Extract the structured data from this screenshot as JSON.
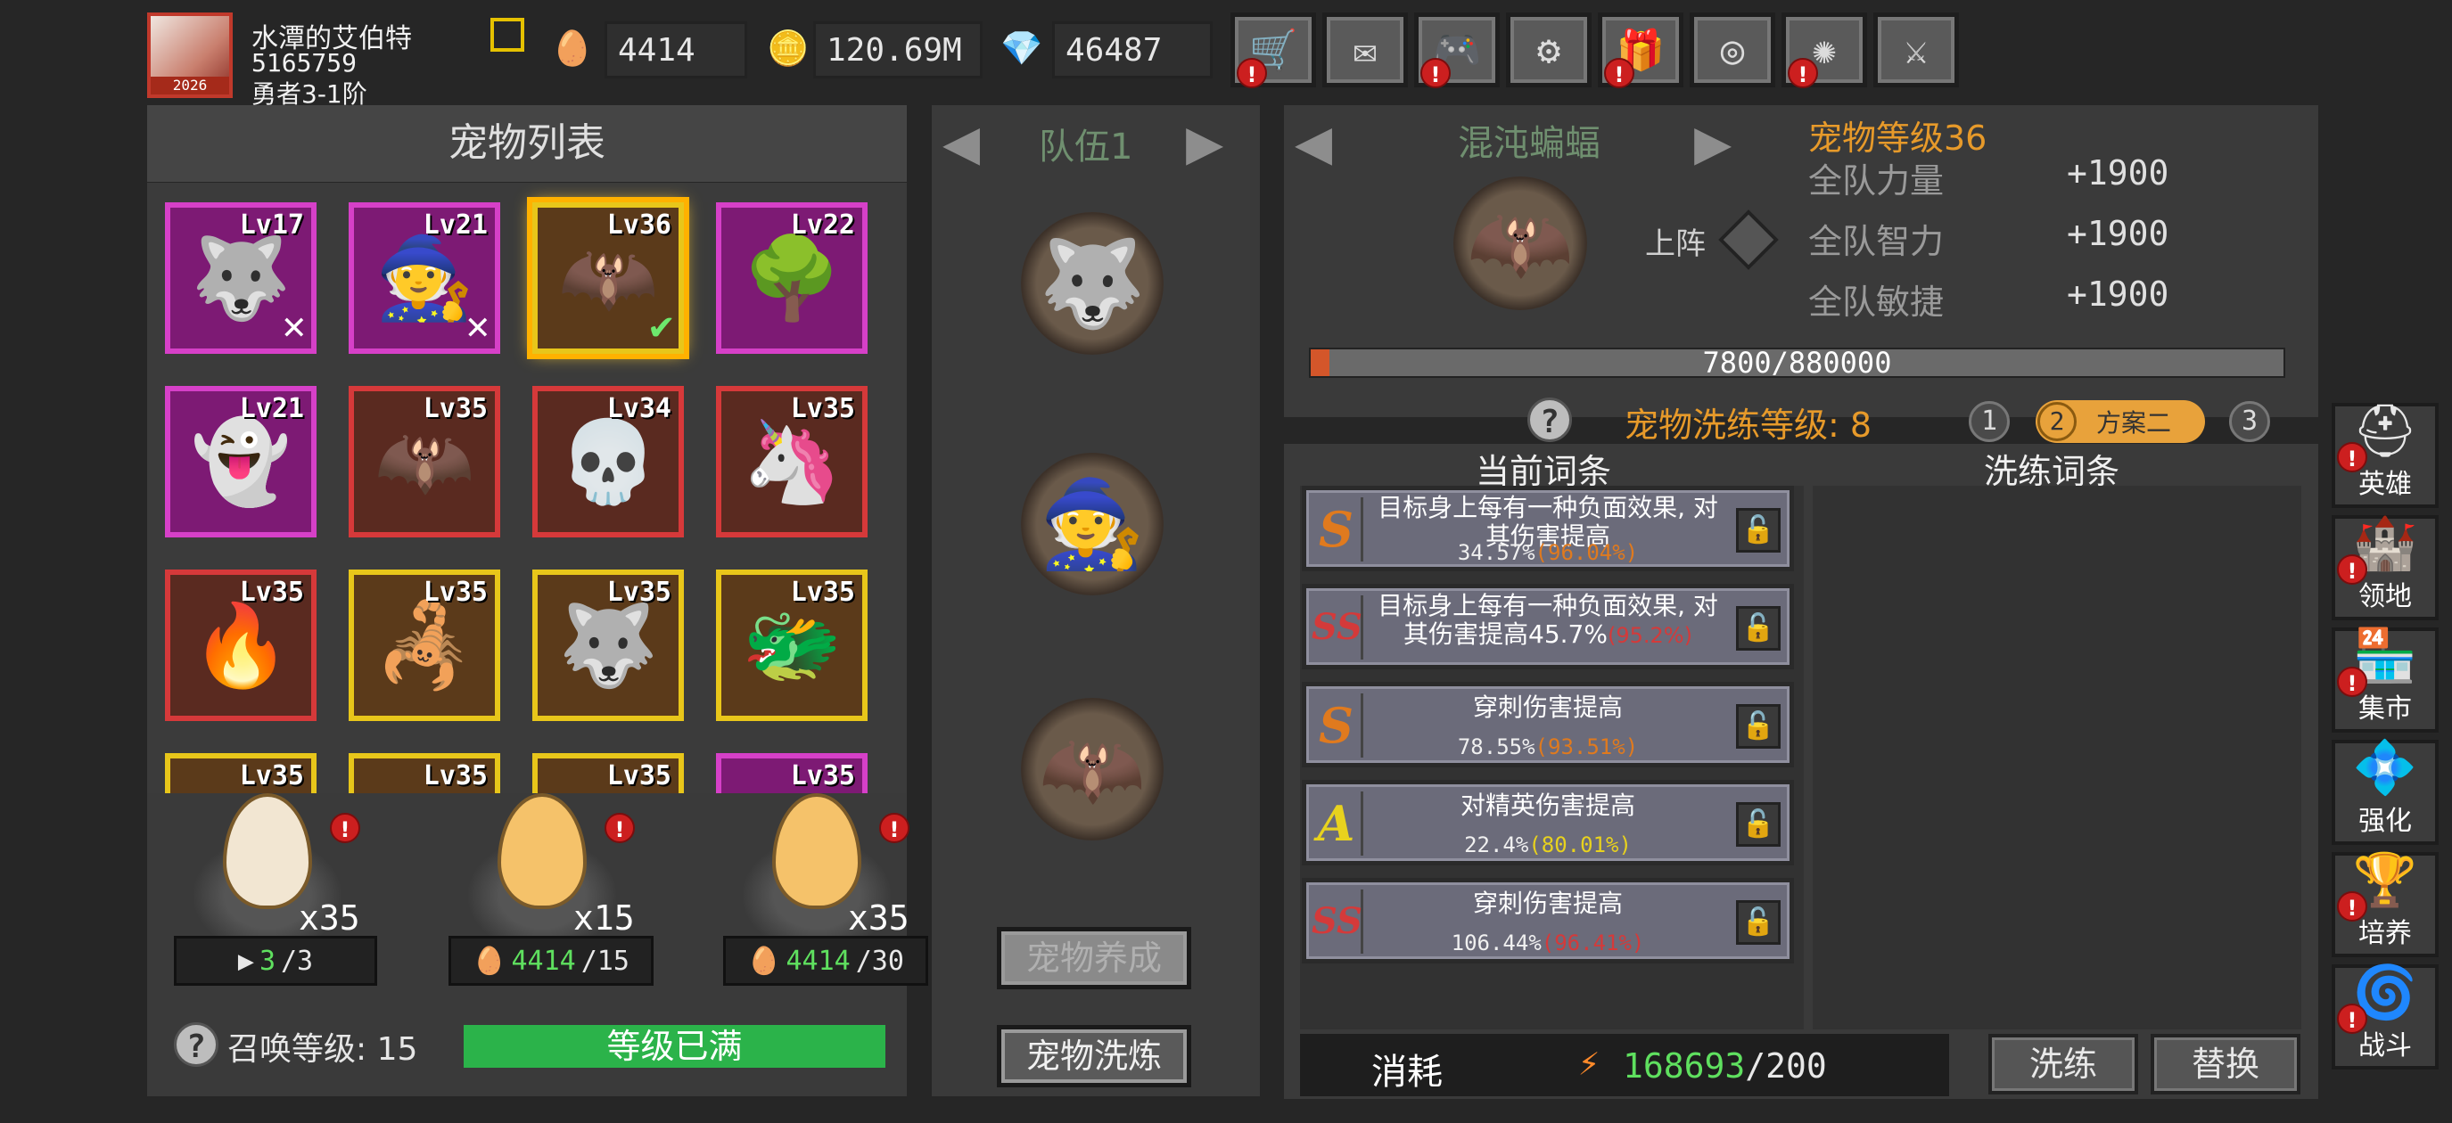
{
  "player": {
    "name": "水潭的艾伯特",
    "id": "5165759",
    "rank": "勇者3-1阶",
    "avatar_year": "2026"
  },
  "resources": [
    {
      "icon": "gold-egg-icon",
      "value": "4414"
    },
    {
      "icon": "gold-coin-plus-icon",
      "value": "120.69M"
    },
    {
      "icon": "diamond-icon",
      "value": "46487"
    }
  ],
  "toolbar": [
    {
      "icon": "cart-icon",
      "glyph": "🛒",
      "alert": true
    },
    {
      "icon": "mail-icon",
      "glyph": "✉",
      "alert": false
    },
    {
      "icon": "gamepad-icon",
      "glyph": "🎮",
      "alert": true
    },
    {
      "icon": "gear-icon",
      "glyph": "⚙",
      "alert": false
    },
    {
      "icon": "gift-icon",
      "glyph": "🎁",
      "alert": true
    },
    {
      "icon": "aperture-icon",
      "glyph": "◎",
      "alert": false
    },
    {
      "icon": "firework-icon",
      "glyph": "✺",
      "alert": true
    },
    {
      "icon": "crossed-swords-disabled-icon",
      "glyph": "⚔",
      "alert": false
    }
  ],
  "pet_list": {
    "title": "宠物列表",
    "pets": [
      {
        "lv": "Lv17",
        "frame": "purple",
        "glyph": "🐺",
        "mark": "x"
      },
      {
        "lv": "Lv21",
        "frame": "purple",
        "glyph": "🧙",
        "mark": "x"
      },
      {
        "lv": "Lv36",
        "frame": "gold",
        "glyph": "🦇",
        "mark": "check",
        "selected": true
      },
      {
        "lv": "Lv22",
        "frame": "purple",
        "glyph": "🌳"
      },
      {
        "lv": "Lv21",
        "frame": "purple",
        "glyph": "👻"
      },
      {
        "lv": "Lv35",
        "frame": "red",
        "glyph": "🦇"
      },
      {
        "lv": "Lv34",
        "frame": "red",
        "glyph": "💀"
      },
      {
        "lv": "Lv35",
        "frame": "red",
        "glyph": "🦄"
      },
      {
        "lv": "Lv35",
        "frame": "red",
        "glyph": "🔥"
      },
      {
        "lv": "Lv35",
        "frame": "gold",
        "glyph": "🦂"
      },
      {
        "lv": "Lv35",
        "frame": "gold",
        "glyph": "🐺"
      },
      {
        "lv": "Lv35",
        "frame": "gold",
        "glyph": "🐲"
      },
      {
        "lv": "Lv35",
        "frame": "gold",
        "glyph": ""
      },
      {
        "lv": "Lv35",
        "frame": "gold",
        "glyph": ""
      },
      {
        "lv": "Lv35",
        "frame": "gold",
        "glyph": ""
      },
      {
        "lv": "Lv35",
        "frame": "purple",
        "glyph": ""
      }
    ]
  },
  "eggs": [
    {
      "count": "x35",
      "cost_have": "3",
      "cost_need": "/3",
      "cost_icon": "ad-video-icon"
    },
    {
      "count": "x15",
      "cost_have": "4414",
      "cost_need": "/15",
      "cost_icon": "gold-egg-icon"
    },
    {
      "count": "x35",
      "cost_have": "4414",
      "cost_need": "/30",
      "cost_icon": "gold-egg-icon"
    }
  ],
  "summon": {
    "label": "召唤等级: 15",
    "status": "等级已满"
  },
  "team": {
    "label": "队伍1",
    "slots": [
      "🐺",
      "🧙",
      "🦇"
    ],
    "btn_train": "宠物养成",
    "btn_wash": "宠物洗炼"
  },
  "detail": {
    "pet_name": "混沌蝙蝠",
    "pet_level": "宠物等级36",
    "deploy": "上阵",
    "stats": [
      {
        "label": "全队力量",
        "value": "+1900"
      },
      {
        "label": "全队智力",
        "value": "+1900"
      },
      {
        "label": "全队敏捷",
        "value": "+1900"
      }
    ],
    "exp_text": "7800/880000",
    "exp_ratio": 0.0089
  },
  "wash": {
    "level_label": "宠物洗练等级: 8",
    "plans": [
      "1",
      "2",
      "3"
    ],
    "active_plan_name": "方案二",
    "current_header": "当前词条",
    "wash_header": "洗练词条",
    "traits": [
      {
        "grade": "S",
        "grade_color": "#e07a1e",
        "line1": "目标身上每有一种负面效果, 对",
        "line1b": "其伤害提高",
        "value": "34.57%",
        "max": "(96.04%)",
        "max_color": "#e07a1e"
      },
      {
        "grade": "SS",
        "grade_color": "#d43a3a",
        "line1": "目标身上每有一种负面效果, 对",
        "line1b": "其伤害提高45.7%",
        "value": "",
        "max": "(95.2%)",
        "max_color": "#d43a3a"
      },
      {
        "grade": "S",
        "grade_color": "#e07a1e",
        "line1": "穿刺伤害提高",
        "line1b": "",
        "value": "78.55%",
        "max": "(93.51%)",
        "max_color": "#e07a1e"
      },
      {
        "grade": "A",
        "grade_color": "#e8d21e",
        "line1": "对精英伤害提高",
        "line1b": "",
        "value": "22.4%",
        "max": "(80.01%)",
        "max_color": "#e8d21e"
      },
      {
        "grade": "SS",
        "grade_color": "#d43a3a",
        "line1": "穿刺伤害提高",
        "line1b": "",
        "value": "106.44%",
        "max": "(96.41%)",
        "max_color": "#d43a3a"
      }
    ],
    "cost_label": "消耗",
    "cost_have": "168693",
    "cost_need": "/200",
    "btn_wash": "洗练",
    "btn_replace": "替换"
  },
  "sidebar": [
    {
      "label": "英雄",
      "icon": "helmet-icon",
      "glyph": "⛑",
      "alert": true
    },
    {
      "label": "领地",
      "icon": "castle-icon",
      "glyph": "🏰",
      "alert": true
    },
    {
      "label": "集市",
      "icon": "shop-icon",
      "glyph": "🏪",
      "alert": true
    },
    {
      "label": "强化",
      "icon": "crystal-icon",
      "glyph": "💠",
      "alert": false
    },
    {
      "label": "培养",
      "icon": "goblet-icon",
      "glyph": "🏆",
      "alert": true
    },
    {
      "label": "战斗",
      "icon": "portal-icon",
      "glyph": "🌀",
      "alert": true
    }
  ]
}
